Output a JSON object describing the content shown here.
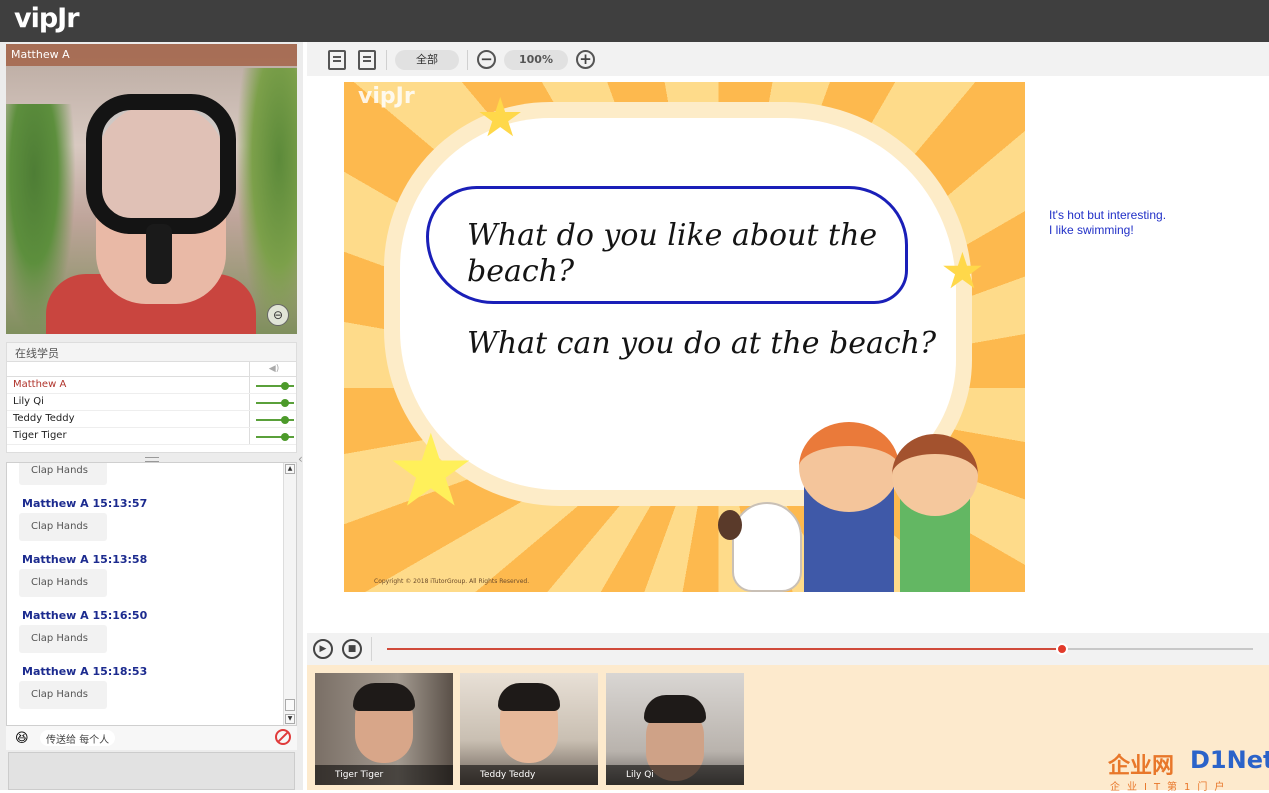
{
  "app": {
    "logo": "vipJr"
  },
  "teacher_video": {
    "name": "Matthew A"
  },
  "roster": {
    "title": "在线学员",
    "students": [
      {
        "name": "Matthew A",
        "role": "teacher",
        "volume": 0.75
      },
      {
        "name": "Lily Qi",
        "role": "student",
        "volume": 0.75
      },
      {
        "name": "Teddy Teddy",
        "role": "student",
        "volume": 0.75
      },
      {
        "name": "Tiger Tiger",
        "role": "student",
        "volume": 0.75
      }
    ]
  },
  "chat": {
    "first_bubble": "Clap Hands",
    "messages": [
      {
        "header": "Matthew A 15:13:57",
        "text": "Clap Hands"
      },
      {
        "header": "Matthew A 15:13:58",
        "text": "Clap Hands"
      },
      {
        "header": "Matthew A 15:16:50",
        "text": "Clap Hands"
      },
      {
        "header": "Matthew A 15:18:53",
        "text": "Clap Hands"
      }
    ],
    "send_to_label": "传送给",
    "send_to_value": "每个人"
  },
  "toolbar": {
    "all_label": "全部",
    "zoom_label": "100%",
    "zoom_out": "−",
    "zoom_in": "+"
  },
  "slide": {
    "logo": "vipJr",
    "question_1": "What do you like about the beach?",
    "question_2": "What can you do at the beach?",
    "copyright": "Copyright © 2018 iTutorGroup. All Rights Reserved."
  },
  "note": {
    "line_1": "It's hot but interesting.",
    "line_2": "I like swimming!"
  },
  "playback": {
    "progress": 0.78
  },
  "student_videos": [
    {
      "name": "Tiger Tiger"
    },
    {
      "name": "Teddy Teddy"
    },
    {
      "name": "Lily Qi"
    }
  ],
  "watermark": {
    "title": "企业网",
    "brand": "D1Net",
    "subtitle": "企业IT第1门户"
  },
  "colors": {
    "topbar": "#3f3f3f",
    "timestamp": "#1c2b8f",
    "note": "#2130c7",
    "progress": "#d04a3a",
    "slider": "#5aa03a"
  }
}
